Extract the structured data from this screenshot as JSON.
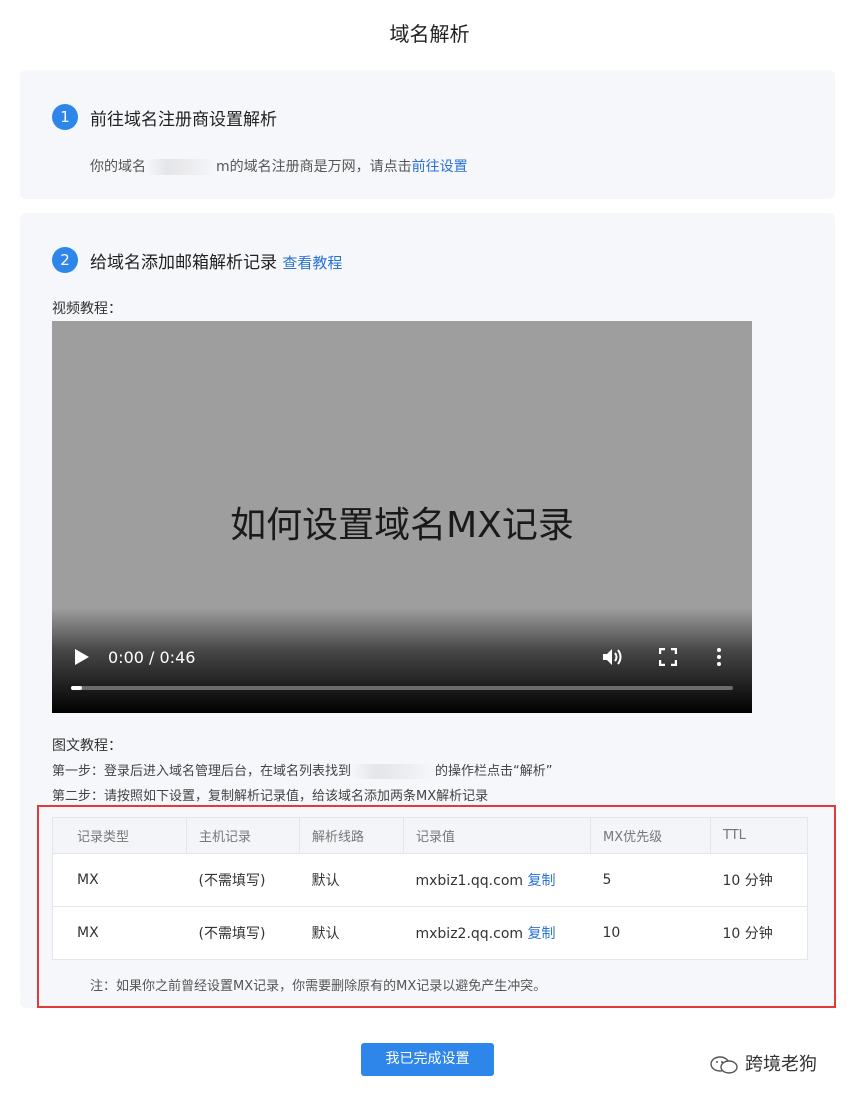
{
  "page": {
    "title": "域名解析"
  },
  "step1": {
    "number": "1",
    "title": "前往域名注册商设置解析",
    "desc_prefix": "你的域名",
    "desc_suffix_char": "m",
    "desc_middle": "的域名注册商是万网，请点击",
    "link": "前往设置"
  },
  "step2": {
    "number": "2",
    "title": "给域名添加邮箱解析记录",
    "link": "查看教程",
    "video_label": "视频教程："
  },
  "video": {
    "caption": "如何设置域名MX记录",
    "time": "0:00 / 0:46",
    "progress": 0.017
  },
  "tutorial": {
    "title": "图文教程：",
    "step1_prefix": "第一步：登录后进入域名管理后台，在域名列表找到",
    "step1_suffix": "的操作栏点击“解析”",
    "step2": "第二步：请按照如下设置，复制解析记录值，给该域名添加两条MX解析记录"
  },
  "table": {
    "headers": [
      "记录类型",
      "主机记录",
      "解析线路",
      "记录值",
      "MX优先级",
      "TTL"
    ],
    "rows": [
      {
        "type": "MX",
        "host": "(不需填写)",
        "line": "默认",
        "value": "mxbiz1.qq.com",
        "copy": "复制",
        "priority": "5",
        "ttl": "10 分钟"
      },
      {
        "type": "MX",
        "host": "(不需填写)",
        "line": "默认",
        "value": "mxbiz2.qq.com",
        "copy": "复制",
        "priority": "10",
        "ttl": "10 分钟"
      }
    ]
  },
  "note": "注：如果你之前曾经设置MX记录，你需要删除原有的MX记录以避免产生冲突。",
  "done_button": "我已完成设置",
  "watermark": "跨境老狗",
  "colors": {
    "primary": "#2f86ea",
    "link": "#2b72d4",
    "highlight_border": "#e23a3a",
    "card_bg": "#f5f7fa"
  }
}
